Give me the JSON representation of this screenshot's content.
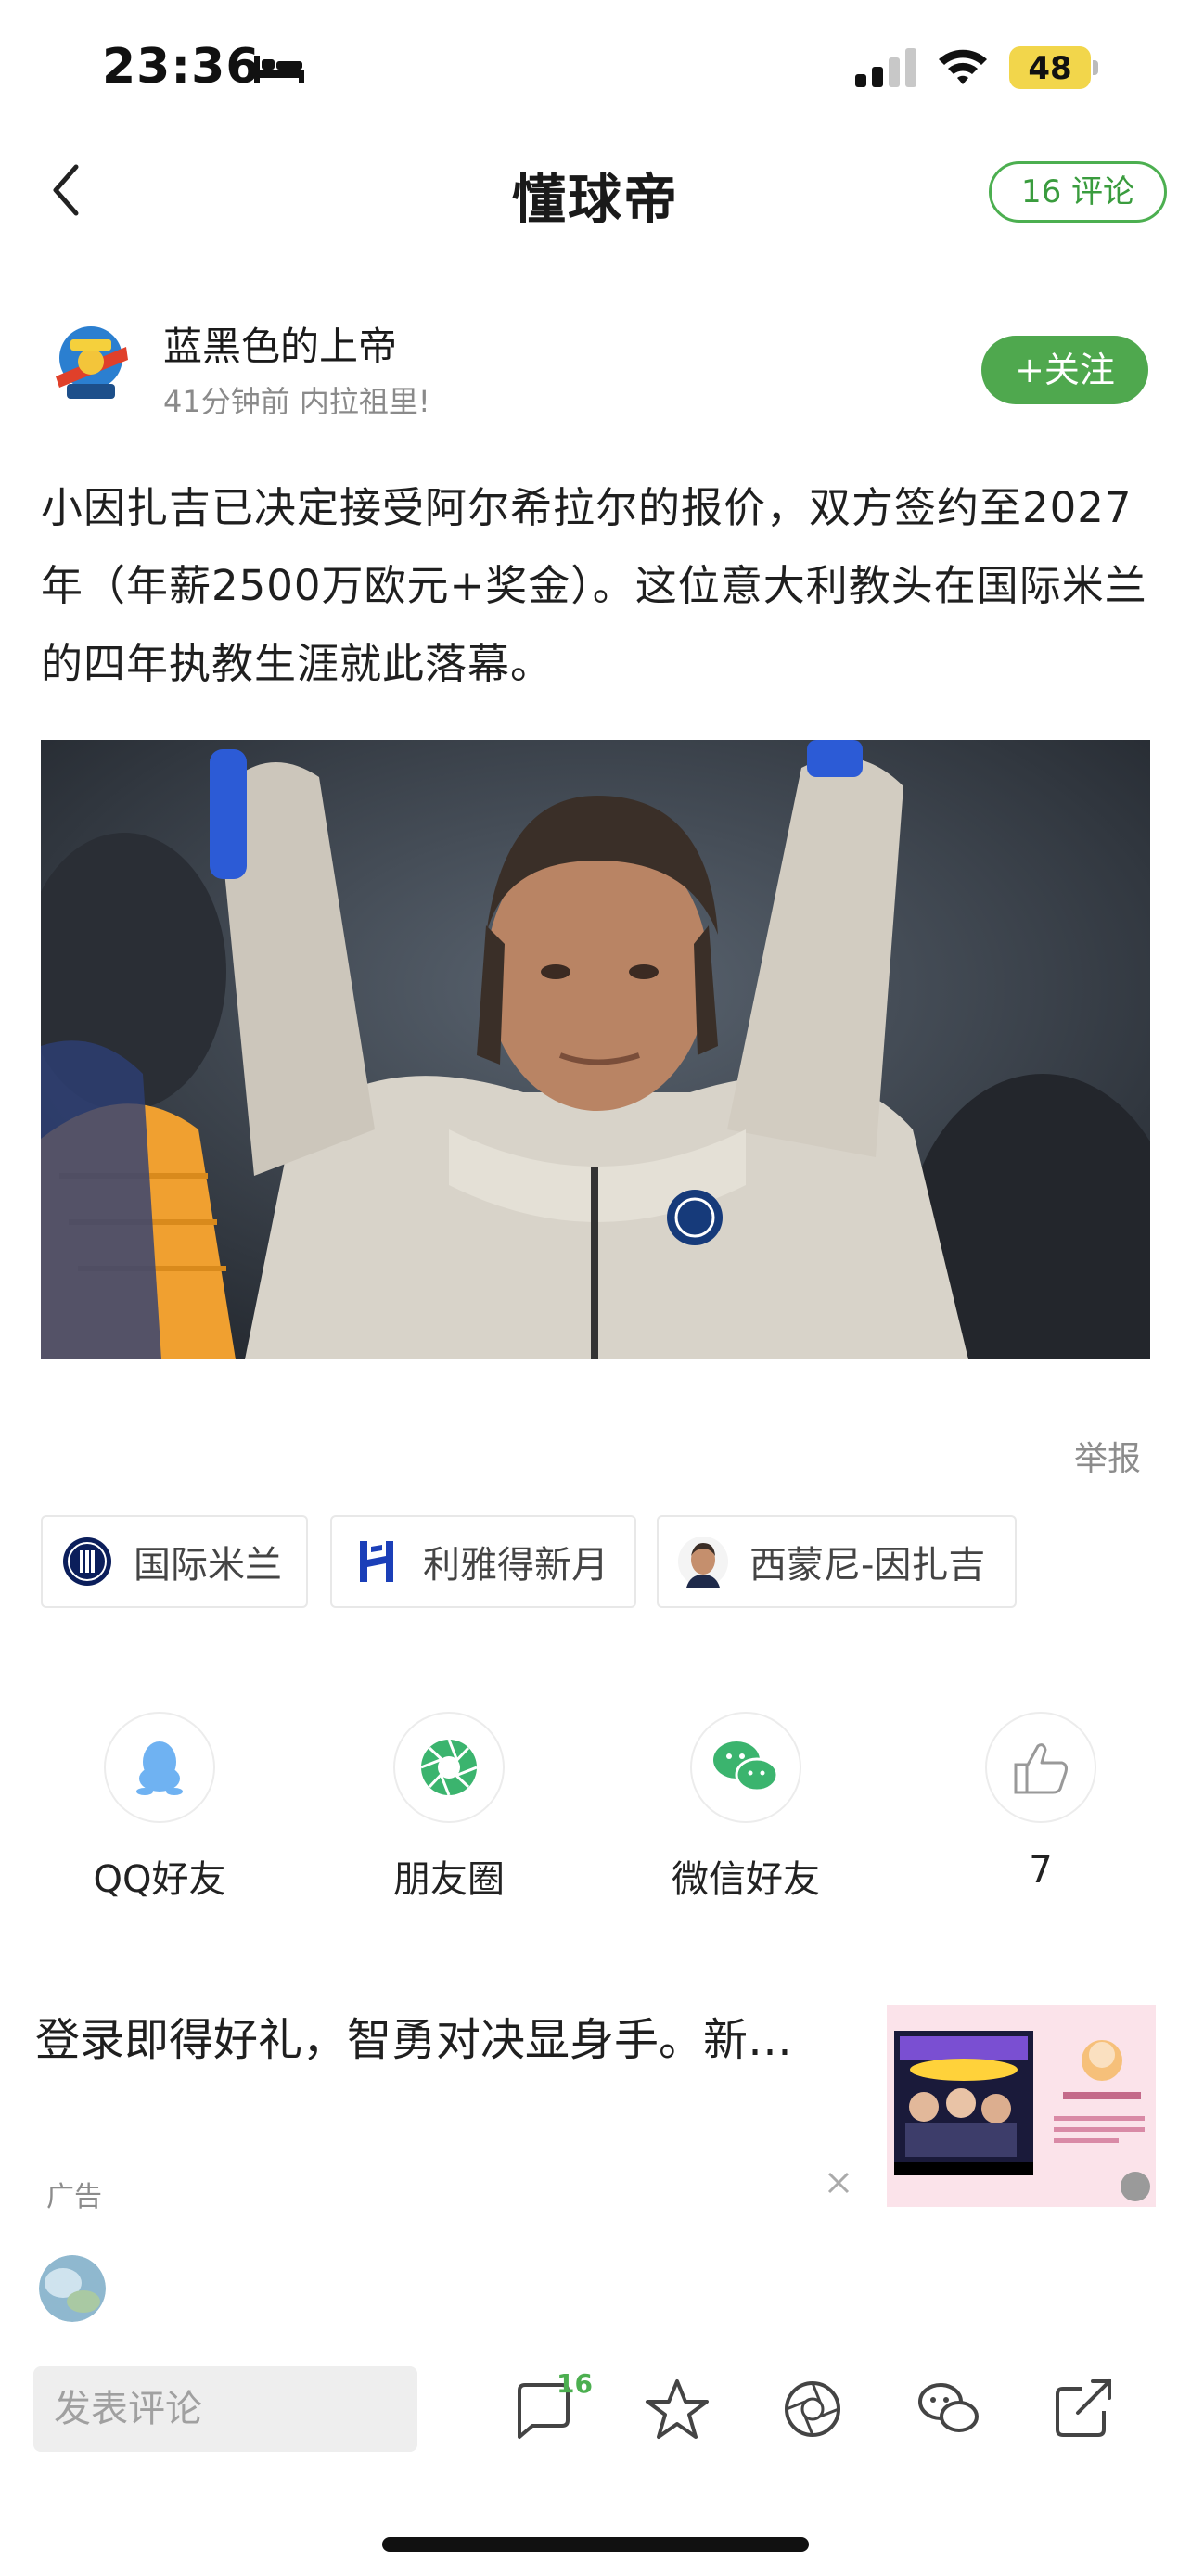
{
  "status_bar": {
    "time": "23:36",
    "battery_level": "48",
    "battery_color": "#f2d64b"
  },
  "nav": {
    "title": "懂球帝",
    "comments_label": "16 评论"
  },
  "author": {
    "name": "蓝黑色的上帝",
    "meta": "41分钟前  内拉祖里!",
    "follow_label": "+关注"
  },
  "article": {
    "text": "小因扎吉已决定接受阿尔希拉尔的报价，双方签约至2027年（年薪2500万欧元+奖金）。这位意大利教头在国际米兰 的四年执教生涯就此落幕。"
  },
  "report_label": "举报",
  "tags": [
    {
      "label": "国际米兰",
      "icon": "inter-logo-icon"
    },
    {
      "label": "利雅得新月",
      "icon": "al-hilal-logo-icon"
    },
    {
      "label": "西蒙尼-因扎吉",
      "icon": "player-avatar-icon"
    }
  ],
  "share": {
    "qq_label": "QQ好友",
    "moments_label": "朋友圈",
    "wechat_label": "微信好友",
    "like_count": "7"
  },
  "ad": {
    "text": "登录即得好礼，智勇对决显身手。新…",
    "label": "广告"
  },
  "bottom_bar": {
    "comment_placeholder": "发表评论",
    "comment_count": "16"
  },
  "colors": {
    "accent_green": "#4fa84e"
  }
}
